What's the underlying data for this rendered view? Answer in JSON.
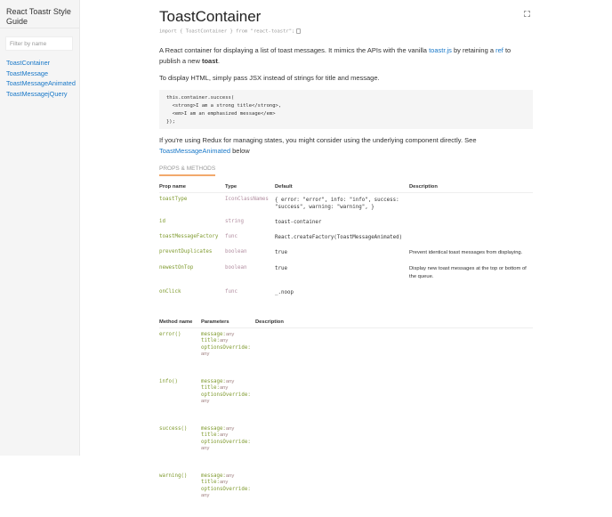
{
  "sidebar": {
    "title": "React Toastr Style Guide",
    "filter_placeholder": "Filter by name",
    "items": [
      "ToastContainer",
      "ToastMessage",
      "ToastMessageAnimated",
      "ToastMessagejQuery"
    ]
  },
  "main": {
    "title": "ToastContainer",
    "import": "import { ToastContainer } from \"react-toastr\";",
    "intro": {
      "a": "A React container for displaying a list of toast messages. It mimics the APIs with the vanilla ",
      "link1": "toastr.js",
      "b": " by retaining a ",
      "link2": "ref",
      "c": " to publish a new ",
      "bold": "toast",
      "d": "."
    },
    "html_note": "To display HTML, simply pass JSX instead of strings for title and message.",
    "code": "this.container.success(\n  <strong>I am a strong title</strong>,\n  <em>I am an emphasized message</em>\n});",
    "redux": {
      "a": "If you're using Redux for managing states, you might consider using the underlying component directly. See ",
      "link": "ToastMessageAnimated",
      "b": " below"
    },
    "section": "PROPS & METHODS",
    "props_headers": [
      "Prop name",
      "Type",
      "Default",
      "Description"
    ],
    "props": [
      {
        "name": "toastType",
        "type": "IconClassNames",
        "default": "{ error: \"error\", info: \"info\", success: \"success\", warning: \"warning\", }",
        "desc": ""
      },
      {
        "name": "id",
        "type": "string",
        "default": "toast-container",
        "desc": ""
      },
      {
        "name": "toastMessageFactory",
        "type": "func",
        "default": "React.createFactory(ToastMessageAnimated)",
        "desc": ""
      },
      {
        "name": "preventDuplicates",
        "type": "boolean",
        "default": "true",
        "desc": "Prevent identical toast messages from displaying."
      },
      {
        "name": "newestOnTop",
        "type": "boolean",
        "default": "true",
        "desc": "Display new toast messages at the top or bottom of the queue."
      },
      {
        "name": "onClick",
        "type": "func",
        "default": "_.noop",
        "desc": ""
      }
    ],
    "methods_headers": [
      "Method name",
      "Parameters",
      "Description"
    ],
    "param_labels": {
      "message": "message:",
      "title": "title:",
      "options": "optionsOverride:",
      "any": "any"
    },
    "methods": [
      "error()",
      "info()",
      "success()",
      "warning()"
    ]
  }
}
